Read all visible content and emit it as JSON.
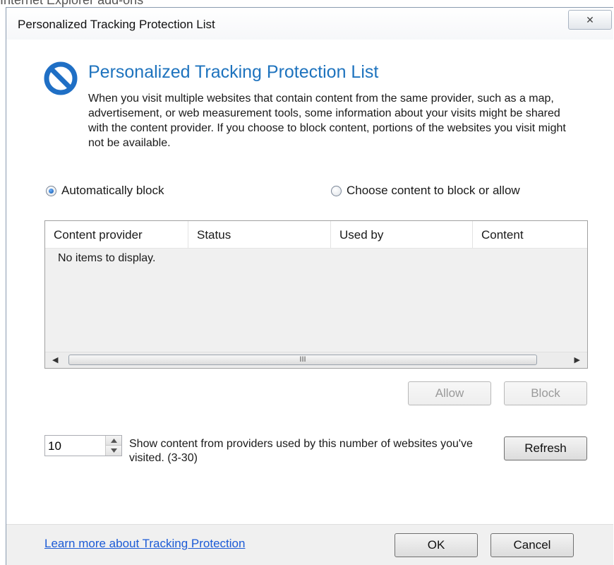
{
  "window": {
    "title": "Personalized Tracking Protection List",
    "close_glyph": "✕"
  },
  "heading": "Personalized Tracking Protection List",
  "description": "When you visit multiple websites that contain content from the same provider, such as a map, advertisement, or web measurement tools, some information about your visits might be shared with the content provider.  If you choose to block content, portions of the websites you visit might not be available.",
  "options": {
    "auto_block": {
      "label": "Automatically block",
      "checked": true
    },
    "choose": {
      "label": "Choose content to block or allow",
      "checked": false
    }
  },
  "list": {
    "columns": [
      "Content provider",
      "Status",
      "Used by",
      "Content"
    ],
    "empty_text": "No items to display.",
    "scroll_left_glyph": "◀",
    "scroll_right_glyph": "▶",
    "scroll_grip": "III"
  },
  "buttons": {
    "allow": "Allow",
    "block": "Block",
    "refresh": "Refresh",
    "ok": "OK",
    "cancel": "Cancel"
  },
  "spinner": {
    "value": "10",
    "label": "Show content from providers used by this number of websites you've visited. (3-30)"
  },
  "footer": {
    "link": "Learn more about Tracking Protection"
  },
  "background_text": "Internet Explorer add-ons",
  "icons": {
    "shield": "block-circle-icon"
  },
  "colors": {
    "heading": "#1e73be",
    "link": "#1c5bd6",
    "icon": "#1f6fc5"
  }
}
